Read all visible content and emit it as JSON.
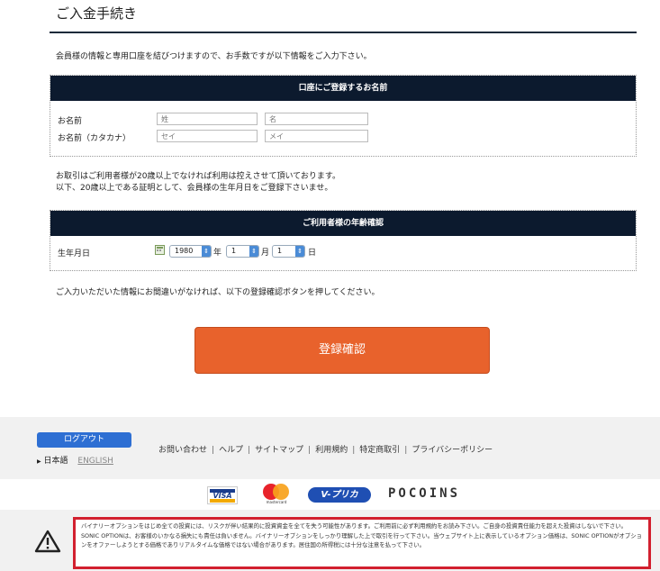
{
  "page_title": "ご入金手続き",
  "intro": "会員様の情報と専用口座を結びつけますので、お手数ですが以下情報をご入力下さい。",
  "name_section": {
    "header": "口座にご登録するお名前",
    "rows": [
      {
        "label": "お名前",
        "placeholder1": "姓",
        "placeholder2": "名"
      },
      {
        "label": "お名前（カタカナ）",
        "placeholder1": "セイ",
        "placeholder2": "メイ"
      }
    ]
  },
  "age_note_line1": "お取引はご利用者様が20歳以上でなければ利用は控えさせて頂いております。",
  "age_note_line2": "以下、20歳以上である証明として、会員様の生年月日をご登録下さいませ。",
  "age_section": {
    "header": "ご利用者様の年齢確認",
    "label": "生年月日",
    "year": "1980",
    "year_unit": "年",
    "month": "1",
    "month_unit": "月",
    "day": "1",
    "day_unit": "日"
  },
  "confirm_note": "ご入力いただいた情報にお間違いがなければ、以下の登録確認ボタンを押してください。",
  "confirm_button": "登録確認",
  "footer": {
    "logout": "ログアウト",
    "lang_ja": "日本語",
    "lang_en": "ENGLISH",
    "links": [
      "お問い合わせ",
      "ヘルプ",
      "サイトマップ",
      "利用規約",
      "特定商取引",
      "プライバシーポリシー"
    ],
    "link_separator": "|"
  },
  "logos": {
    "visa": "VISA",
    "mastercard_caption": "mastercard",
    "vpurika": "V-プリカ",
    "pocoins": "POCOINS"
  },
  "warning": "バイナリーオプションをはじめ全ての投資には、リスクが伴い結果的に投資資金を全てを失う可能性があります。ご利用前に必ず利用規約をお読み下さい。ご自身の投資責任能力を超えた投資はしないで下さい。SONIC OPTIONは、お客様のいかなる損失にも責任は負いません。バイナリーオプションをしっかり理解した上で取引を行って下さい。当ウェブサイト上に表示しているオプション価格は、SONIC OPTIONがオプションをオファーしようとする価格でありリアルタイムな価格ではない場合があります。居住国の所得税には十分な注意を払って下さい。",
  "colors": {
    "header_bg": "#0c1a2e",
    "button": "#e8622c",
    "link_blue": "#2e6fd3",
    "warning_border": "#d2202f"
  }
}
